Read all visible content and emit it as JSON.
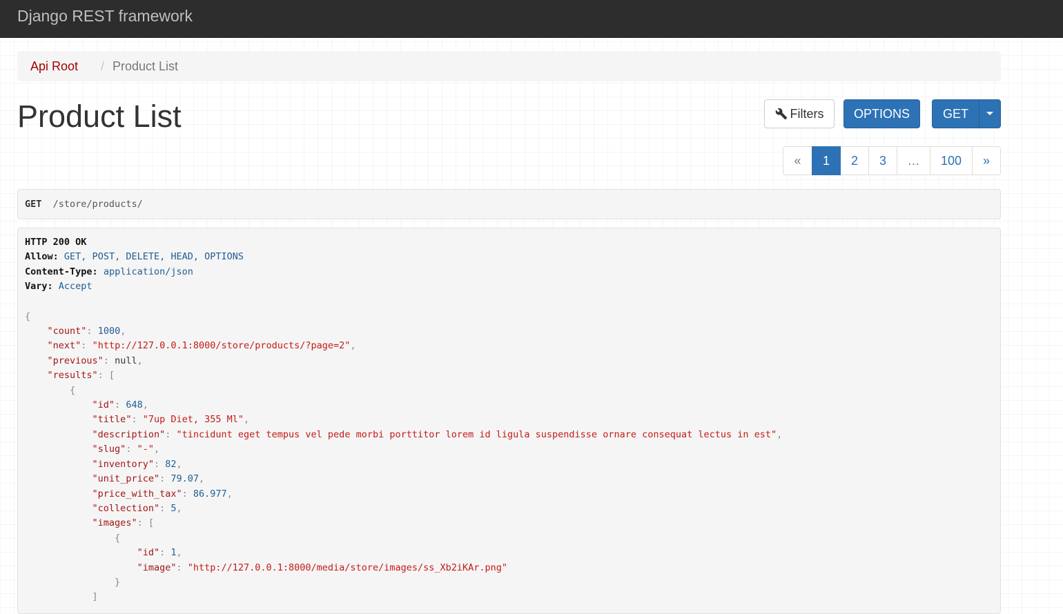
{
  "navbar": {
    "brand": "Django REST framework"
  },
  "breadcrumb": {
    "root": "Api Root",
    "separator": "/",
    "current": "Product List"
  },
  "page": {
    "title": "Product List"
  },
  "toolbar": {
    "filters_label": "Filters",
    "filters_icon": "wrench-icon",
    "options_label": "OPTIONS",
    "get_label": "GET",
    "get_dropdown_icon": "caret-down-icon"
  },
  "pagination": {
    "prev": "«",
    "pages": [
      "1",
      "2",
      "3"
    ],
    "ellipsis": "…",
    "last_page": "100",
    "next": "»",
    "active": "1"
  },
  "request": {
    "method": "GET",
    "path": "/store/products/"
  },
  "response": {
    "status": "HTTP 200 OK",
    "headers": [
      {
        "name": "Allow:",
        "value": "GET, POST, DELETE, HEAD, OPTIONS"
      },
      {
        "name": "Content-Type:",
        "value": "application/json"
      },
      {
        "name": "Vary:",
        "value": "Accept"
      }
    ],
    "body": {
      "count": "1000",
      "next": "\"http://127.0.0.1:8000/store/products/?page=2\"",
      "previous": "null",
      "result": {
        "id": "648",
        "title": "\"7up Diet, 355 Ml\"",
        "description": "\"tincidunt eget tempus vel pede morbi porttitor lorem id ligula suspendisse ornare consequat lectus in est\"",
        "slug": "\"-\"",
        "inventory": "82",
        "unit_price": "79.07",
        "price_with_tax": "86.977",
        "collection": "5",
        "image": {
          "id": "1",
          "image": "\"http://127.0.0.1:8000/media/store/images/ss_Xb2iKAr.png\""
        }
      }
    }
  },
  "colors": {
    "navbar_bg": "#2d2d2d",
    "primary": "#2d72b5",
    "breadcrumb_link": "#a30000",
    "json_string": "#c41a16",
    "json_number": "#1f5c94"
  }
}
